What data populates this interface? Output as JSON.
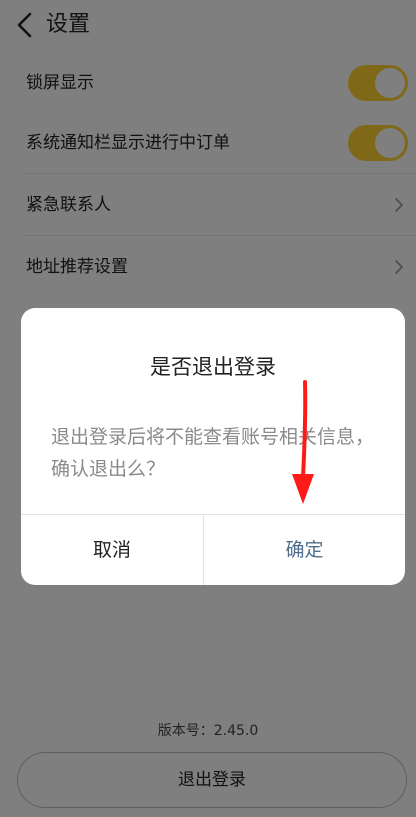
{
  "header": {
    "title": "设置"
  },
  "settings": {
    "lock_screen": "锁屏显示",
    "notification_bar": "系统通知栏显示进行中订单",
    "emergency_contact": "紧急联系人",
    "address_recommend": "地址推荐设置"
  },
  "footer": {
    "version": "版本号：2.45.0",
    "logout_label": "退出登录"
  },
  "dialog": {
    "title": "是否退出登录",
    "message": "退出登录后将不能查看账号相关信息，确认退出么？",
    "cancel_label": "取消",
    "confirm_label": "确定"
  },
  "colors": {
    "toggle_on": "#fed12e",
    "confirm_text": "#4e6d8c",
    "annotation_arrow": "#ff1a1a"
  }
}
